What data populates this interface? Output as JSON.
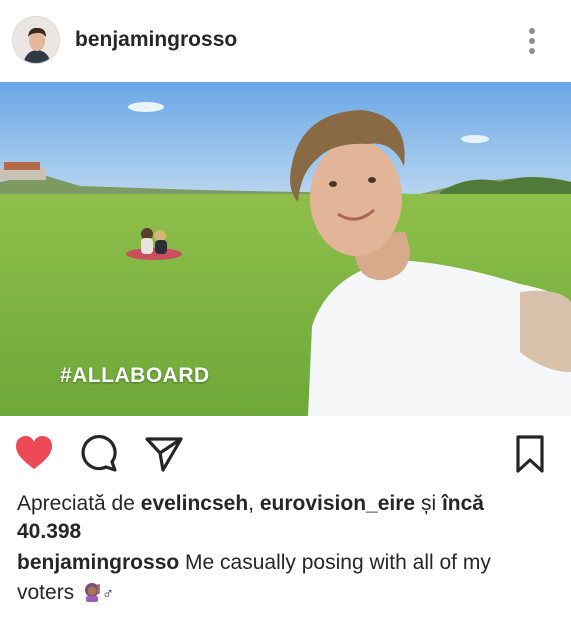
{
  "post": {
    "username": "benjamingrosso",
    "image_overlay_text": "#ALLABOARD",
    "liked": true,
    "colors": {
      "heart": "#ed4956",
      "text": "#262626",
      "meta_icon": "#8e8e8e"
    }
  },
  "likes": {
    "prefix": "Apreciată de",
    "user1": "evelincseh",
    "sep": ",",
    "user2": "eurovision_eire",
    "conj": "și",
    "more": "încă",
    "count": "40.398"
  },
  "caption": {
    "username": "benjamingrosso",
    "text": "Me casually posing with all of my voters",
    "emoji_icon": "woman-raising-hand-emoji",
    "male_sign": "♂"
  },
  "icons": {
    "like": "heart-icon",
    "comment": "comment-icon",
    "share": "send-icon",
    "save": "bookmark-icon",
    "more": "more-vertical-icon"
  }
}
